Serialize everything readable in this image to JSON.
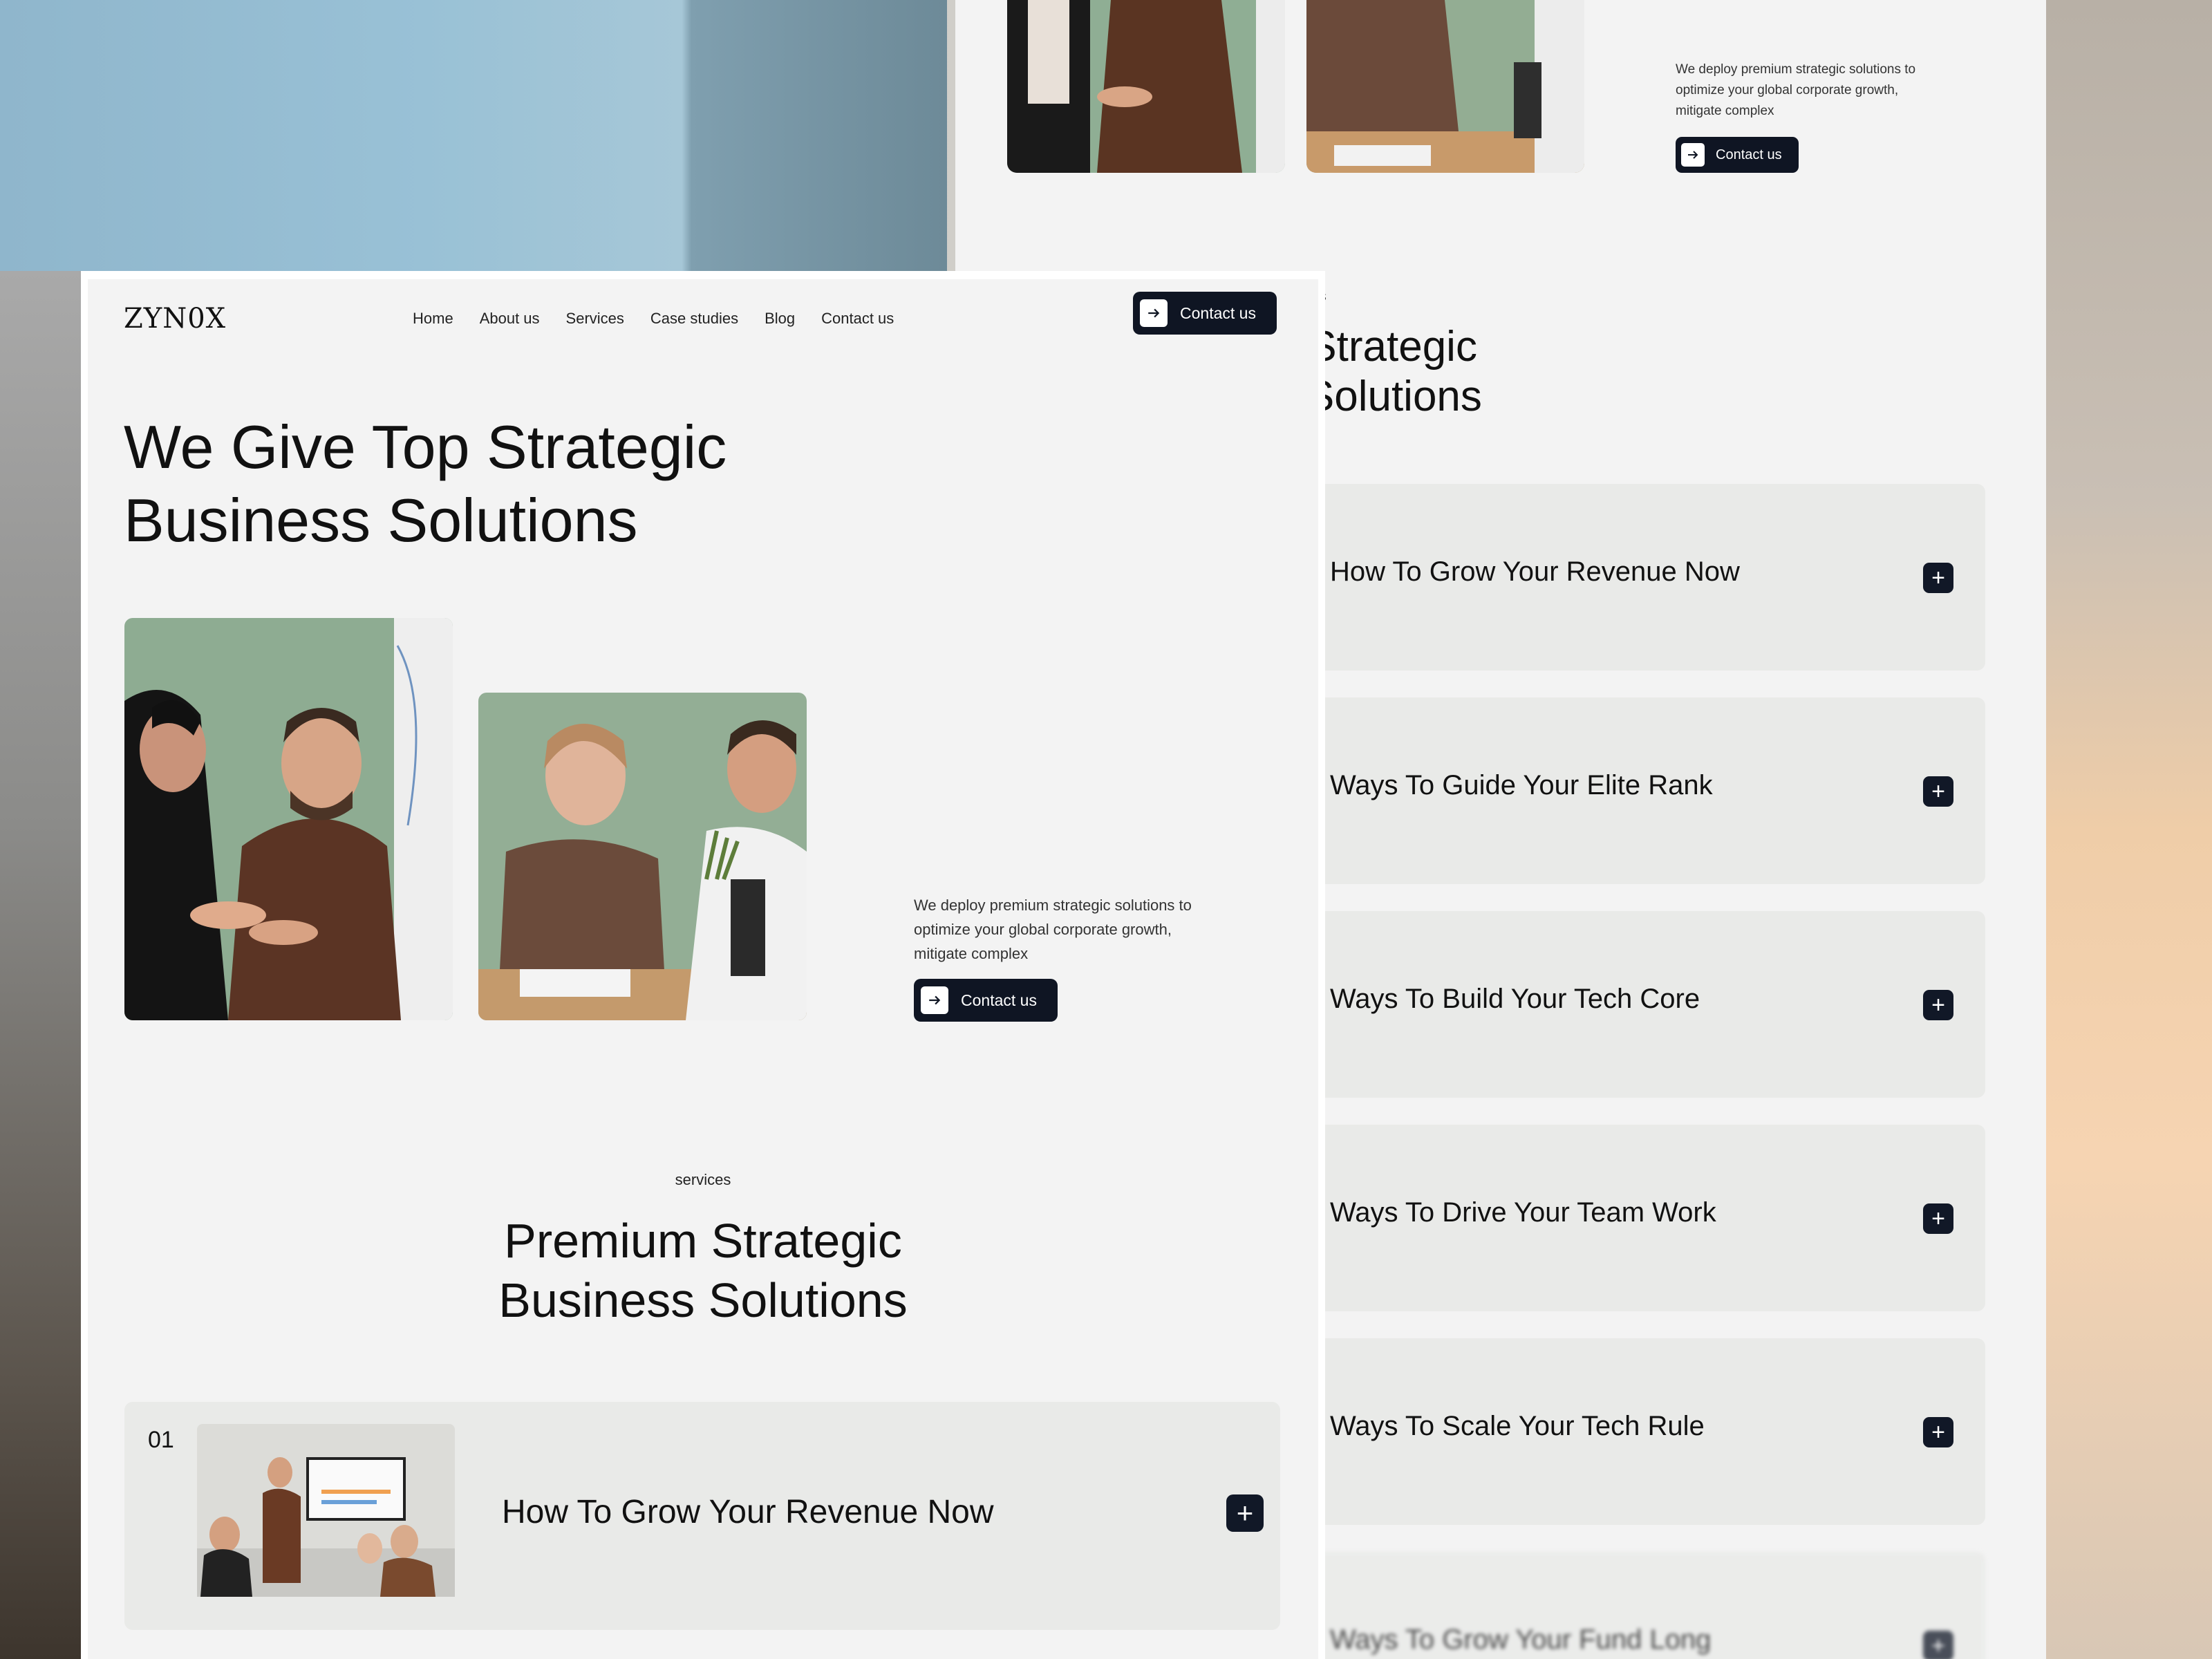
{
  "brand": {
    "logo_text": "ZYN0X"
  },
  "nav": {
    "items": [
      "Home",
      "About us",
      "Services",
      "Case studies",
      "Blog",
      "Contact us"
    ]
  },
  "header": {
    "cta_label": "Contact us"
  },
  "hero": {
    "title_line1": "We Give Top Strategic",
    "title_line2": "Business Solutions",
    "description": "We deploy premium strategic solutions to optimize your global corporate growth, mitigate complex",
    "cta_label": "Contact us"
  },
  "services": {
    "eyebrow": "services",
    "title_line1": "Premium Strategic",
    "title_line2": "Business Solutions",
    "first_card": {
      "number": "01",
      "label": "How To Grow Your Revenue Now"
    }
  },
  "back_window": {
    "description": "We deploy premium strategic solutions to optimize your global corporate growth, mitigate complex",
    "cta_label": "Contact us",
    "eyebrow": "services",
    "title_line1": "Premium Strategic",
    "title_line2": "Business Solutions",
    "items": [
      "How To Grow Your Revenue Now",
      "Ways To Guide Your Elite Rank",
      "Ways To Build Your Tech Core",
      "Ways To Drive Your Team Work",
      "Ways To Scale Your Tech Rule",
      "Ways To Grow Your Fund Long"
    ]
  },
  "colors": {
    "primary_dark": "#0f1523",
    "page_bg": "#f3f3f3",
    "card_bg": "#e9eae8"
  }
}
